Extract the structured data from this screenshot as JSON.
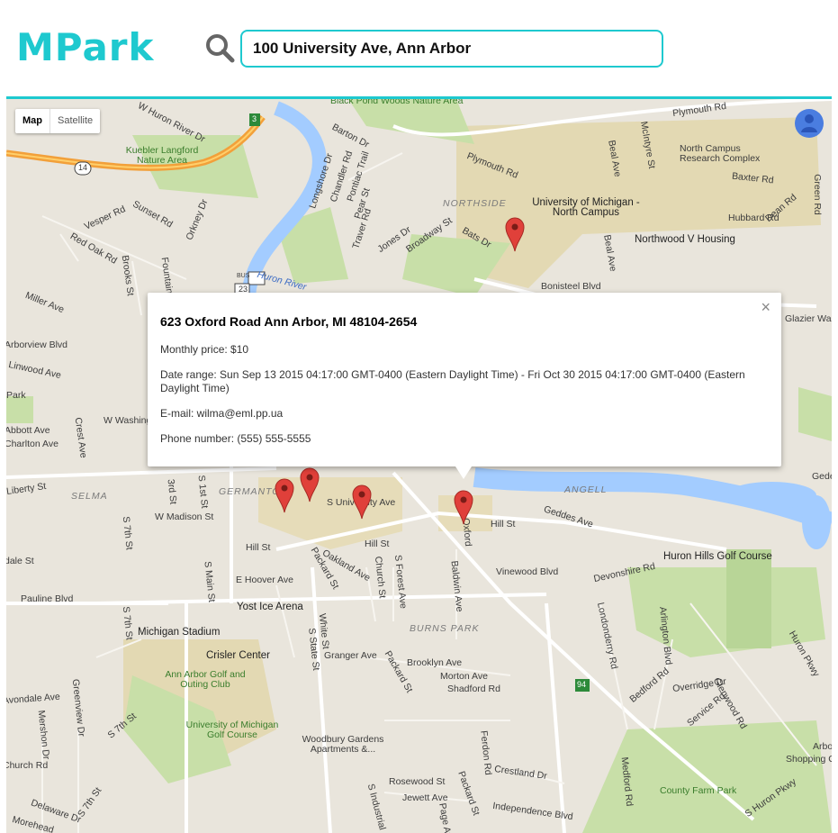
{
  "app": {
    "title": "MPark"
  },
  "search": {
    "value": "100 University Ave, Ann Arbor"
  },
  "map": {
    "controls": {
      "map_label": "Map",
      "satellite_label": "Satellite"
    },
    "labels": {
      "black_pond": "Black Pond Woods Nature Area",
      "w_huron_river_dr": "W Huron River Dr",
      "barton_dr": "Barton Dr",
      "plymouth_rd": "Plymouth Rd",
      "plymouth_rd2": "Plymouth Rd",
      "mcintyre": "McIntyre St",
      "north_campus_rc": "North Campus Research Complex",
      "green_rd": "Green Rd",
      "kuebler": "Kuebler Langford Nature Area",
      "longshore": "Longshore Dr",
      "chandler": "Chandler Rd",
      "pontiac": "Pontiac Trail",
      "baxter": "Baxter Rd",
      "northside": "NORTHSIDE",
      "um_north": "University of Michigan - North Campus",
      "dean_rd": "Dean Rd",
      "hubbard": "Hubbard Rd",
      "vesper": "Vesper Rd",
      "sunset": "Sunset Rd",
      "orkney": "Orkney Dr",
      "pear": "Pear St",
      "traver": "Traver Rd",
      "jones": "Jones Dr",
      "broadway": "Broadway St",
      "bats": "Bats Dr",
      "beal": "Beal Ave",
      "beal2": "Beal Ave",
      "northwood": "Northwood V Housing",
      "red_oak": "Red Oak Rd",
      "brooks": "Brooks St",
      "fountain": "Fountain",
      "huron_river": "Huron River",
      "bonisteel": "Bonisteel Blvd",
      "miller": "Miller Ave",
      "glazier": "Glazier Wa",
      "arborview": "Arborview Blvd",
      "linwood": "Linwood Ave",
      "park": "Park",
      "washington": "W Washing",
      "abbott": "Abbott Ave",
      "charlton": "Charlton Ave",
      "crest": "Crest Ave",
      "liberty": "Liberty St",
      "gede": "Gede",
      "selma": "SELMA",
      "third": "3rd St",
      "first": "S 1st St",
      "germantown": "GERMANTO",
      "s_university": "S University Ave",
      "angell": "ANGELL",
      "geddes": "Geddes Ave",
      "hill_st": "Hill St",
      "oxford": "Oxford",
      "seventh": "S 7th St",
      "w_madison": "W Madison St",
      "hill2": "Hill St",
      "hill3": "Hill St",
      "huron_hills": "Huron Hills Golf Course",
      "dale": "dale St",
      "main": "S Main St",
      "packard": "Packard St",
      "oakland": "Oakland Ave",
      "church": "Church St",
      "forest": "S Forest Ave",
      "baldwin": "Baldwin Ave",
      "vinewood": "Vinewood Blvd",
      "devonshire": "Devonshire Rd",
      "e_hoover": "E Hoover Ave",
      "pauline": "Pauline Blvd",
      "yost": "Yost Ice Arena",
      "burns_park": "BURNS PARK",
      "longshore2": "Londonderry Rd",
      "arlington": "Arlington Blvd",
      "huron_pkwy": "Huron Pkwy",
      "s_7th2": "S 7th St",
      "michigan_stadium": "Michigan Stadium",
      "white": "White St",
      "s_state": "S State St",
      "crisler": "Crisler Center",
      "granger": "Granger Ave",
      "packard2": "Packard St",
      "brooklyn": "Brooklyn Ave",
      "morton": "Morton Ave",
      "shadford": "Shadford Rd",
      "bedford": "Bedford Rd",
      "overridge": "Overridge Dr",
      "glenwood": "Glenwood Rd",
      "service": "Service Rd",
      "ann_arbor_golf": "Ann Arbor Golf and Outing Club",
      "avondale": "Avondale Ave",
      "greenview": "Greenview Dr",
      "mershon": "Mershon Dr",
      "s_7th3": "S 7th St",
      "um_golf": "University of Michigan Golf Course",
      "woodbury": "Woodbury Gardens Apartments &...",
      "ferdon": "Ferdon Rd",
      "arbo": "Arbo",
      "shopping": "Shopping C",
      "church_rd": "Church Rd",
      "rosewood": "Rosewood St",
      "crestland": "Crestland Dr",
      "medford": "Medford Rd",
      "jewett": "Jewett Ave",
      "s_industrial": "S Industrial",
      "packard3": "Packard St",
      "independence": "Independence Blvd",
      "county_farm": "County Farm Park",
      "s_huron_pkwy": "S Huron Pkwy",
      "delaware": "Delaware Dr",
      "morehead": "Morehead",
      "s_7th4": "S 7th St",
      "page": "Page Av",
      "hwy14": "14",
      "hwy23": "23",
      "hwy3": "3",
      "hwy94": "94",
      "bus": "BUS"
    },
    "info_window": {
      "address": "623 Oxford Road Ann Arbor, MI 48104-2654",
      "monthly_price": "Monthly price: $10",
      "date_range": "Date range: Sun Sep 13 2015 04:17:00 GMT-0400 (Eastern Daylight Time) - Fri Oct 30 2015 04:17:00 GMT-0400 (Eastern Daylight Time)",
      "email": "E-mail: wilma@eml.pp.ua",
      "phone": "Phone number: (555) 555-5555",
      "close_glyph": "×"
    },
    "colors": {
      "accent": "#1ec9cf",
      "marker": "#e0403a",
      "water": "#a3ccff",
      "park": "#c8dfa8",
      "campus": "#e3d9b3"
    }
  }
}
